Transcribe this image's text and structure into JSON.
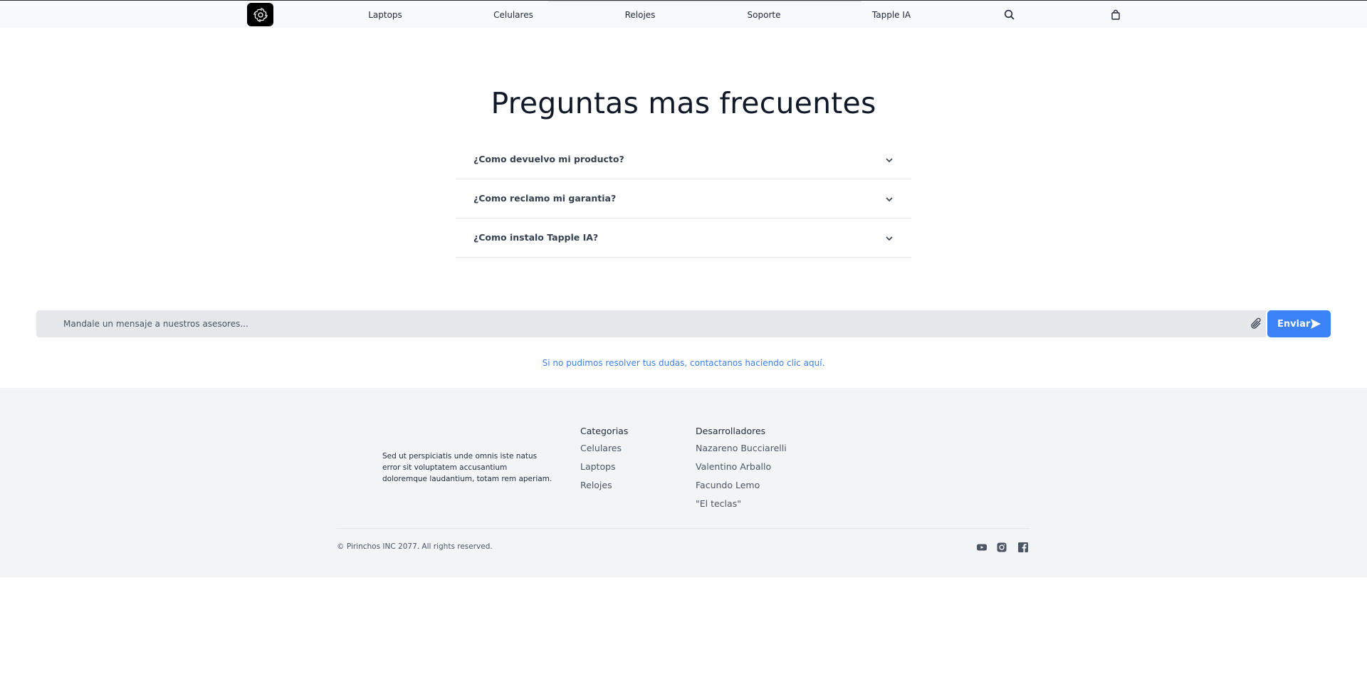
{
  "nav": {
    "links": [
      "Laptops",
      "Celulares",
      "Relojes",
      "Soporte",
      "Tapple IA"
    ],
    "icons": {
      "logo": "tapple-logo-icon",
      "search": "search-icon",
      "cart": "shopping-bag-icon"
    }
  },
  "faq": {
    "title": "Preguntas mas frecuentes",
    "items": [
      "¿Como devuelvo mi producto?",
      "¿Como reclamo mi garantia?",
      "¿Como instalo Tapple IA?"
    ]
  },
  "chat": {
    "placeholder": "Mandale un mensaje a nuestros asesores...",
    "send_label": "Enviar",
    "contact_text": "Si no pudimos resolver tus dudas, contactanos haciendo clic aquí."
  },
  "footer": {
    "description": "Sed ut perspiciatis unde omnis iste natus error sit voluptatem accusantium doloremque laudantium, totam rem aperiam.",
    "categories": {
      "heading": "Categorias",
      "links": [
        "Celulares",
        "Laptops",
        "Relojes"
      ]
    },
    "developers": {
      "heading": "Desarrolladores",
      "links": [
        "Nazareno Bucciarelli",
        "Valentino Arballo",
        "Facundo Lemo",
        "\"El teclas\""
      ]
    },
    "copyright": "© Pirinchos INC 2077. All rights reserved.",
    "social_icons": [
      "youtube-icon",
      "instagram-icon",
      "facebook-icon"
    ]
  },
  "colors": {
    "accent": "#3b82f6",
    "nav_bg": "#f8f9fa",
    "footer_bg": "#f3f4f6",
    "chat_bg": "#e5e7eb"
  }
}
